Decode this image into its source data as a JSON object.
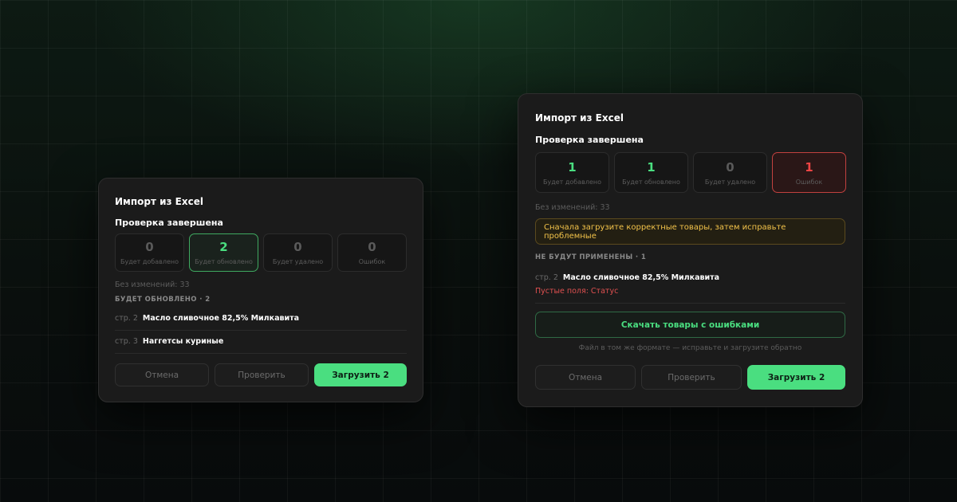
{
  "left_dialog": {
    "title": "Импорт из Excel",
    "subtitle": "Проверка завершена",
    "stats": [
      {
        "value": "0",
        "label": "Будет добавлено"
      },
      {
        "value": "2",
        "label": "Будет обновлено"
      },
      {
        "value": "0",
        "label": "Будет удалено"
      },
      {
        "value": "0",
        "label": "Ошибок"
      }
    ],
    "unchanged": "Без изменений: 33",
    "section_title": "БУДЕТ ОБНОВЛЕНО · 2",
    "rows": [
      {
        "idx": "стр. 2",
        "name": "Масло сливочное 82,5% Милкавита"
      },
      {
        "idx": "стр. 3",
        "name": "Наггетсы куриные"
      }
    ],
    "buttons": {
      "cancel": "Отмена",
      "check": "Проверить",
      "upload": "Загрузить 2"
    }
  },
  "right_dialog": {
    "title": "Импорт из Excel",
    "subtitle": "Проверка завершена",
    "stats": [
      {
        "value": "1",
        "label": "Будет добавлено"
      },
      {
        "value": "1",
        "label": "Будет обновлено"
      },
      {
        "value": "0",
        "label": "Будет удалено"
      },
      {
        "value": "1",
        "label": "Ошибок"
      }
    ],
    "unchanged": "Без изменений: 33",
    "warning": "Сначала загрузите корректные товары, затем исправьте проблемные",
    "section_title": "НЕ БУДУТ ПРИМЕНЕНЫ · 1",
    "error_row": {
      "idx": "стр. 2",
      "name": "Масло сливочное 82,5% Милкавита",
      "error": "Пустые поля: Статус"
    },
    "download_button": "Скачать товары с ошибками",
    "download_hint": "Файл в том же формате — исправьте и загрузите обратно",
    "buttons": {
      "cancel": "Отмена",
      "check": "Проверить",
      "upload": "Загрузить 2"
    }
  },
  "colors": {
    "accent": "#4ade80",
    "error": "#ef4444",
    "warning": "#f3c34a"
  }
}
